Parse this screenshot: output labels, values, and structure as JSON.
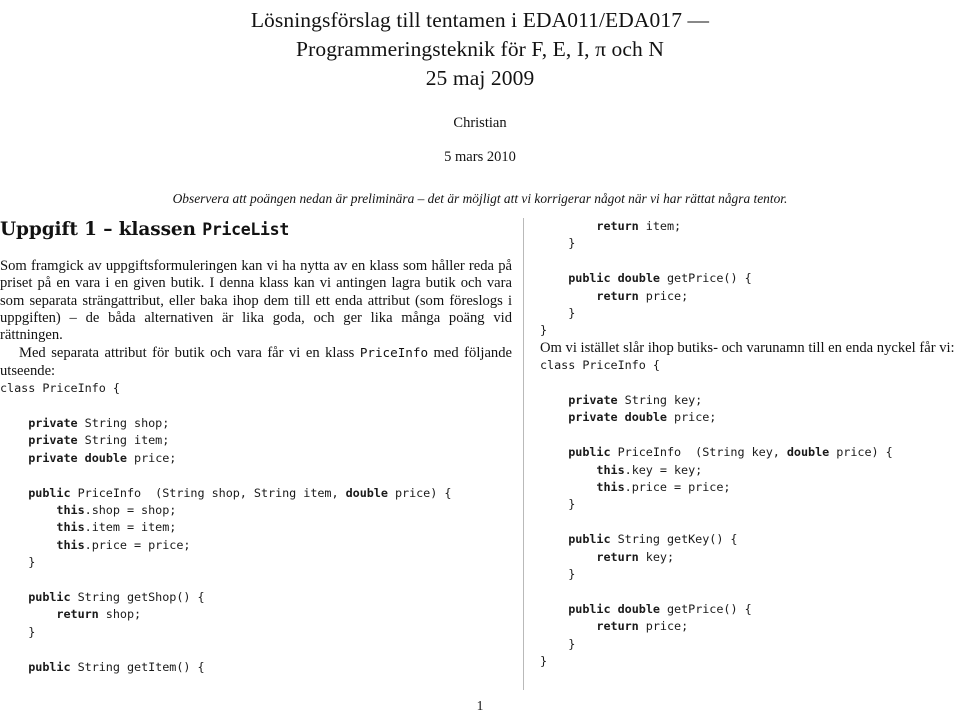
{
  "document": {
    "title_lines": [
      "Lösningsförslag till tentamen i EDA011/EDA017 —",
      "Programmeringsteknik för F, E, I, π och N",
      "25 maj 2009"
    ],
    "author": "Christian",
    "date": "5 mars 2010",
    "notice": "Observera att poängen nedan är preliminära – det är möjligt att vi korrigerar något när vi har rättat några tentor.",
    "page_number": "1"
  },
  "left_column": {
    "heading_text": "Uppgift 1 – klassen ",
    "heading_mono": "PriceList",
    "paragraph_1_a": "Som framgick av uppgiftsformuleringen kan vi ha nytta av en klass som håller reda på priset på en vara i en given butik. I denna klass kan vi antingen lagra butik och vara som separata strängattribut, eller baka ihop dem till ett enda attribut (som föreslogs i uppgiften) – de båda alternativen är lika goda, och ger lika många poäng vid rättningen.",
    "paragraph_2_a": "Med separata attribut för butik och vara får vi en klass ",
    "paragraph_2_mono": "PriceInfo",
    "paragraph_2_b": " med följande utseende:",
    "code": "class PriceInfo {\n\n    @private@ String shop;\n    @private@ String item;\n    @private@ @double@ price;\n\n    @public@ PriceInfo  (String shop, String item, @double@ price) {\n        @this@.shop = shop;\n        @this@.item = item;\n        @this@.price = price;\n    }\n\n    @public@ String getShop() {\n        @return@ shop;\n    }\n\n    @public@ String getItem() {"
  },
  "right_column": {
    "code_top": "        @return@ item;\n    }\n\n    @public@ @double@ getPrice() {\n        @return@ price;\n    }\n}",
    "lead_text": "Om vi istället slår ihop butiks- och varunamn till en enda nyckel får vi:",
    "code_bottom": "class PriceInfo {\n\n    @private@ String key;\n    @private@ @double@ price;\n\n    @public@ PriceInfo  (String key, @double@ price) {\n        @this@.key = key;\n        @this@.price = price;\n    }\n\n    @public@ String getKey() {\n        @return@ key;\n    }\n\n    @public@ @double@ getPrice() {\n        @return@ price;\n    }\n}"
  },
  "colors": {
    "text": "#121212",
    "code": "#1a1a1a",
    "rule": "#b9b9b9",
    "background": "#ffffff"
  }
}
